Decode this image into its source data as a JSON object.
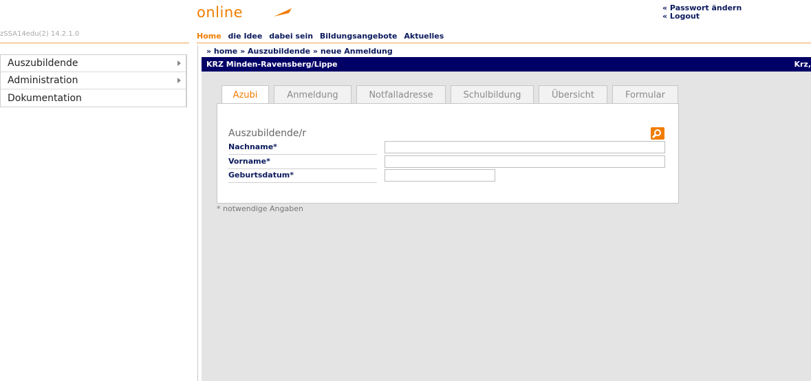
{
  "header": {
    "logo_text": "online",
    "version": "zSSA14edu(2) 14.2.1.0",
    "top_links": [
      "« Passwort ändern",
      "« Logout"
    ]
  },
  "main_nav": {
    "items": [
      "Home",
      "die Idee",
      "dabei sein",
      "Bildungsangebote",
      "Aktuelles"
    ],
    "active": "Home"
  },
  "sidebar": {
    "items": [
      {
        "label": "Auszubildende",
        "has_submenu": true
      },
      {
        "label": "Administration",
        "has_submenu": true
      },
      {
        "label": "Dokumentation",
        "has_submenu": false
      }
    ]
  },
  "breadcrumb": [
    "» home",
    "» Auszubildende",
    "» neue Anmeldung"
  ],
  "title_bar": {
    "left": "KRZ Minden-Ravensberg/Lippe",
    "right": "Krz,"
  },
  "tabs": {
    "items": [
      "Azubi",
      "Anmeldung",
      "Notfalladresse",
      "Schulbildung",
      "Übersicht",
      "Formular"
    ],
    "active": "Azubi"
  },
  "form": {
    "section_title": "Auszubildende/r",
    "fields": [
      {
        "label": "Nachname*",
        "value": ""
      },
      {
        "label": "Vorname*",
        "value": ""
      },
      {
        "label": "Geburtsdatum*",
        "value": ""
      }
    ],
    "note": "* notwendige Angaben"
  },
  "colors": {
    "accent": "#f07d00",
    "navy": "#000066",
    "link": "#0b1a5c",
    "content_bg": "#e4e4e4"
  }
}
